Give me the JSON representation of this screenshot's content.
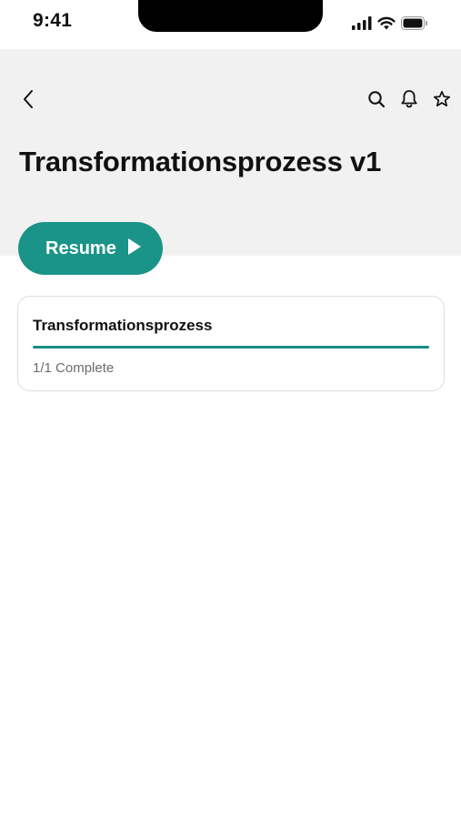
{
  "status_bar": {
    "time": "9:41",
    "icons": [
      "cellular-signal-icon",
      "wifi-icon",
      "battery-icon"
    ]
  },
  "header": {
    "back_icon": "chevron-left-icon",
    "actions": [
      "search-icon",
      "bell-icon",
      "star-icon"
    ],
    "title": "Transformationsprozess v1"
  },
  "resume_button": {
    "label": "Resume",
    "icon": "play-icon"
  },
  "section": {
    "title": "Transformationsprozess",
    "progress": 1.0,
    "status": "1/1 Complete"
  },
  "colors": {
    "accent": "#1a9488",
    "header_bg": "#f1f1f1",
    "muted_text": "#6b6b6b"
  }
}
